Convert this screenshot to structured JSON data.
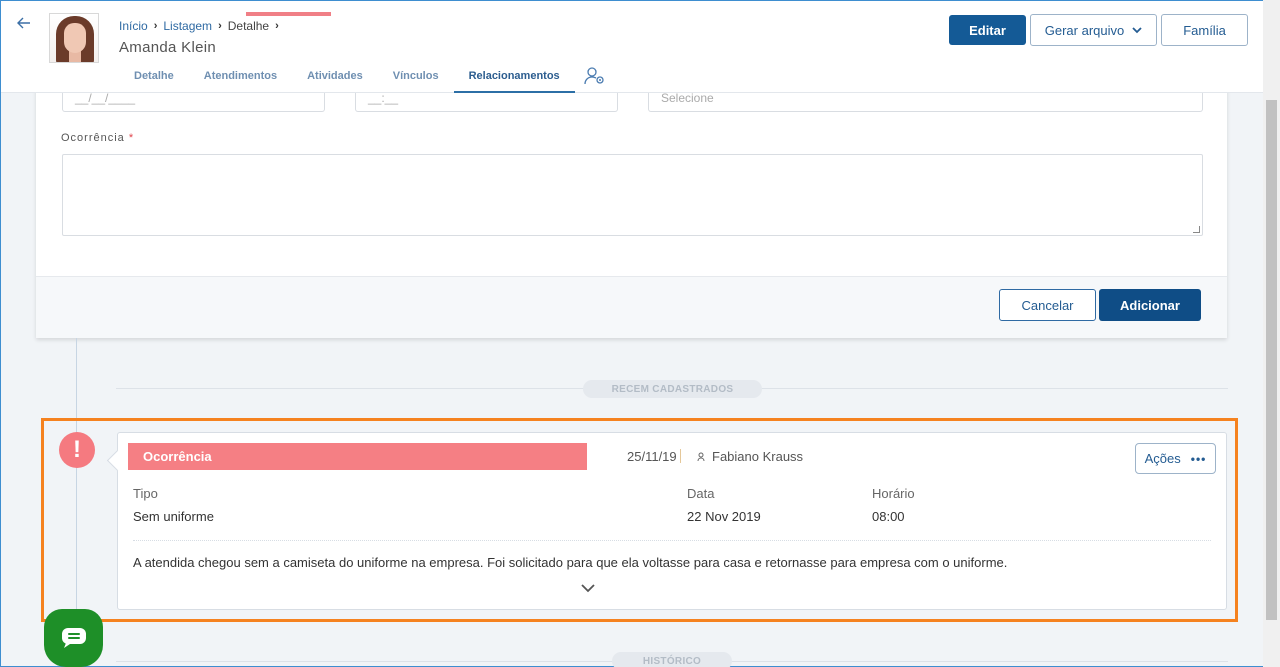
{
  "header": {
    "breadcrumb": [
      "Início",
      "Listagem",
      "Detalhe"
    ],
    "person_name": "Amanda Klein",
    "tabs": [
      "Detalhe",
      "Atendimentos",
      "Atividades",
      "Vínculos",
      "Relacionamentos"
    ],
    "active_tab": "Relacionamentos",
    "buttons": {
      "edit": "Editar",
      "generate": "Gerar arquivo",
      "family": "Família"
    }
  },
  "form": {
    "date_partial": "__/__/____",
    "time_partial": "__:__",
    "select_partial": "Selecione",
    "occurrence_label": "Ocorrência",
    "required_mark": "*",
    "occurrence_value": "",
    "cancel_label": "Cancelar",
    "add_label": "Adicionar"
  },
  "timeline": {
    "recent_label": "RECEM CADASTRADOS",
    "history_label": "HISTÓRICO"
  },
  "event": {
    "type_badge": "Ocorrência",
    "date": "25/11/19",
    "user": "Fabiano Krauss",
    "actions_label": "Ações",
    "fields": {
      "tipo_label": "Tipo",
      "tipo_value": "Sem uniforme",
      "data_label": "Data",
      "data_value": "22 Nov 2019",
      "horario_label": "Horário",
      "horario_value": "08:00"
    },
    "description": "A atendida chegou sem a camiseta do uniforme na empresa. Foi solicitado para que ela voltasse para casa e retornasse para empresa com o uniforme.",
    "icon": "exclamation-icon"
  },
  "colors": {
    "primary": "#145a96",
    "badge": "#f57f84",
    "highlight": "#f5821f",
    "chat": "#1e8f28"
  }
}
